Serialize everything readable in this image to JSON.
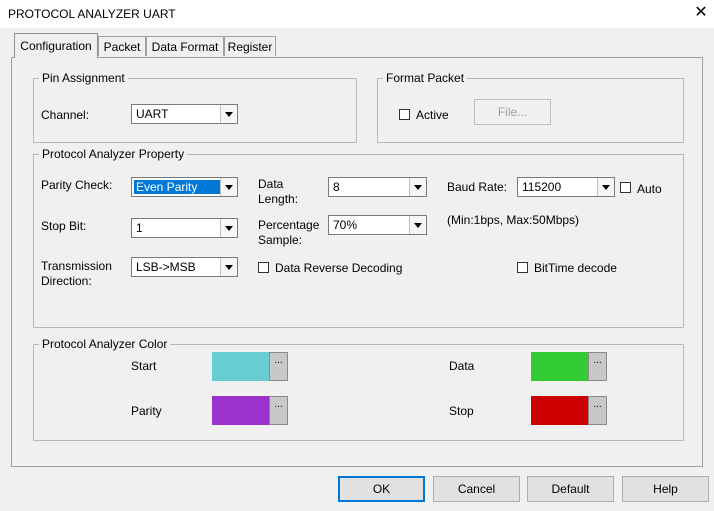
{
  "window": {
    "title": "PROTOCOL ANALYZER UART",
    "close_glyph": "✕"
  },
  "tabs": [
    {
      "label": "Configuration",
      "active": true
    },
    {
      "label": "Packet"
    },
    {
      "label": "Data Format"
    },
    {
      "label": "Register"
    }
  ],
  "pin_assignment": {
    "title": "Pin Assignment",
    "channel_label": "Channel:",
    "channel_value": "UART"
  },
  "format_packet": {
    "title": "Format Packet",
    "active_label": "Active",
    "active_checked": false,
    "file_button": "File..."
  },
  "property": {
    "title": "Protocol Analyzer Property",
    "parity_label": "Parity Check:",
    "parity_value": "Even Parity",
    "data_length_label_1": "Data",
    "data_length_label_2": "Length:",
    "data_length_value": "8",
    "baud_label": "Baud Rate:",
    "baud_value": "115200",
    "auto_label": "Auto",
    "auto_checked": false,
    "stop_bit_label": "Stop Bit:",
    "stop_bit_value": "1",
    "percentage_label_1": "Percentage",
    "percentage_label_2": "Sample:",
    "percentage_value": "70%",
    "range_note": "(Min:1bps, Max:50Mbps)",
    "transmission_label_1": "Transmission",
    "transmission_label_2": "Direction:",
    "transmission_value": "LSB->MSB",
    "reverse_label": "Data Reverse Decoding",
    "reverse_checked": false,
    "bittime_label": "BitTime decode",
    "bittime_checked": false
  },
  "color": {
    "title": "Protocol Analyzer Color",
    "dots": "...",
    "start_label": "Start",
    "start_color": "#66cdd1",
    "data_label": "Data",
    "data_color": "#33cc33",
    "parity_label": "Parity",
    "parity_color": "#9933cc",
    "stop_label": "Stop",
    "stop_color": "#cc0000"
  },
  "buttons": {
    "ok": "OK",
    "cancel": "Cancel",
    "default": "Default",
    "help": "Help"
  }
}
